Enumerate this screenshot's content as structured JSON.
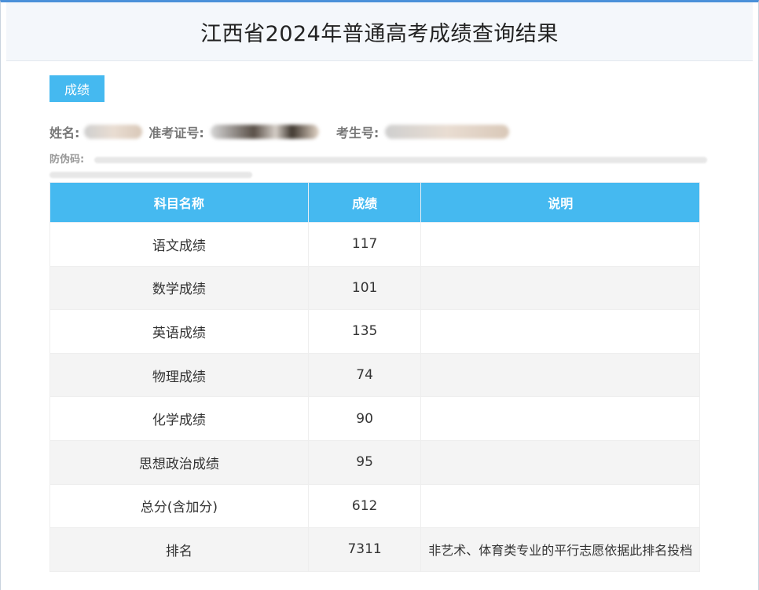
{
  "page": {
    "title": "江西省2024年普通高考成绩查询结果",
    "tab_label": "成绩"
  },
  "candidate": {
    "name_label": "姓名:",
    "admission_label": "准考证号:",
    "examinee_label": "考生号:",
    "anti_fake_label": "防伪码:"
  },
  "table": {
    "headers": [
      "科目名称",
      "成绩",
      "说明"
    ],
    "rows": [
      {
        "subject": "语文成绩",
        "score": "117",
        "note": ""
      },
      {
        "subject": "数学成绩",
        "score": "101",
        "note": ""
      },
      {
        "subject": "英语成绩",
        "score": "135",
        "note": ""
      },
      {
        "subject": "物理成绩",
        "score": "74",
        "note": ""
      },
      {
        "subject": "化学成绩",
        "score": "90",
        "note": ""
      },
      {
        "subject": "思想政治成绩",
        "score": "95",
        "note": ""
      },
      {
        "subject": "总分(含加分)",
        "score": "612",
        "note": ""
      },
      {
        "subject": "排名",
        "score": "7311",
        "note": "非艺术、体育类专业的平行志愿依据此排名投档"
      }
    ]
  },
  "colors": {
    "accent": "#45b9f0",
    "header_bg": "#f4f7fb",
    "stripe": "#f4f4f4"
  }
}
